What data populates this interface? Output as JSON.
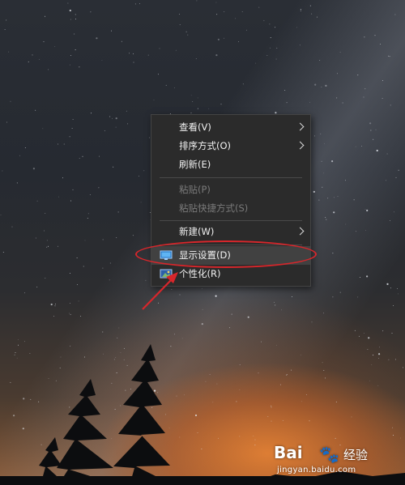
{
  "context_menu": {
    "items": [
      {
        "label": "查看(V)",
        "has_submenu": true,
        "enabled": true
      },
      {
        "label": "排序方式(O)",
        "has_submenu": true,
        "enabled": true
      },
      {
        "label": "刷新(E)",
        "has_submenu": false,
        "enabled": true
      },
      {
        "label": "粘贴(P)",
        "has_submenu": false,
        "enabled": false
      },
      {
        "label": "粘贴快捷方式(S)",
        "has_submenu": false,
        "enabled": false
      },
      {
        "label": "新建(W)",
        "has_submenu": true,
        "enabled": true
      },
      {
        "label": "显示设置(D)",
        "has_submenu": false,
        "enabled": true,
        "icon": "display-settings-icon",
        "highlighted": true
      },
      {
        "label": "个性化(R)",
        "has_submenu": false,
        "enabled": true,
        "icon": "personalize-icon"
      }
    ]
  },
  "annotation": {
    "color": "#d7262b",
    "target": "显示设置(D)"
  },
  "watermark": {
    "brand": "Bai",
    "brand_suffix": "经验",
    "url": "jingyan.baidu.com"
  }
}
